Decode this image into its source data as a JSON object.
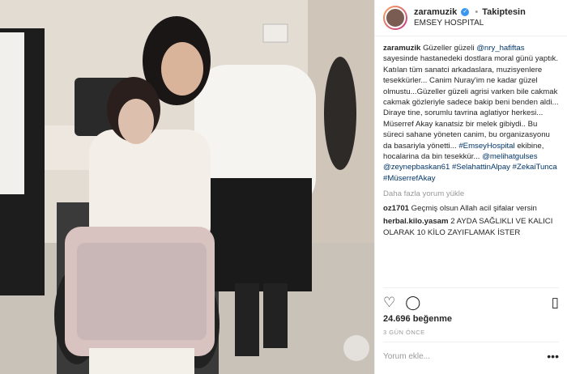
{
  "post": {
    "username": "zaramuzik",
    "follow_status": "Takiptesin",
    "location": "EMSEY HOSPITAL",
    "caption_user": "zaramuzik",
    "caption_parts": [
      {
        "t": "Güzeller güzeli ",
        "k": "text"
      },
      {
        "t": "@nry_hafiftas",
        "k": "link"
      },
      {
        "t": " sayesinde hastanedeki dostlara moral günü yaptık. Katılan tüm sanatci arkadaslara, muzisyenlere tesekkürler... Canim Nuray'im ne kadar güzel olmustu...Güzeller güzeli agrisi varken bile cakmak cakmak gözleriyle sadece bakip beni benden aldi... Diraye tine, sorumlu tavrina aglatiyor herkesi... Müserref Akay kanatsiz bir melek gibiydi.. Bu süreci sahane yöneten canim, bu organizasyonu da basariyla yönetti... ",
        "k": "text"
      },
      {
        "t": "#EmseyHospital",
        "k": "link"
      },
      {
        "t": " ekibine, hocalarina da bin tesekkür... ",
        "k": "text"
      },
      {
        "t": "@melihatgulses",
        "k": "link"
      },
      {
        "t": " ",
        "k": "text"
      },
      {
        "t": "@zeynepbaskan61",
        "k": "link"
      },
      {
        "t": " ",
        "k": "text"
      },
      {
        "t": "#SelahattinAlpay",
        "k": "link"
      },
      {
        "t": " ",
        "k": "text"
      },
      {
        "t": "#ZekaiTunca",
        "k": "link"
      },
      {
        "t": " ",
        "k": "text"
      },
      {
        "t": "#MüserrefAkay",
        "k": "link"
      }
    ],
    "load_more": "Daha fazla yorum yükle",
    "comments": [
      {
        "user": "oz1701",
        "text": "Geçmiş olsun Allah acil şifalar versin"
      },
      {
        "user": "herbal.kilo.yasam",
        "text": "2 AYDA SAĞLIKLI VE KALICI OLARAK 10 KİLO ZAYIFLAMAK İSTER"
      }
    ],
    "likes": "24.696 beğenme",
    "time_ago": "3 GÜN ÖNCE",
    "comment_placeholder": "Yorum ekle...",
    "more_dots": "•••"
  },
  "icons": {
    "heart": "♡",
    "comment": "◯",
    "bookmark": "▯"
  },
  "colors": {
    "link": "#003569",
    "verified": "#3897f0",
    "muted": "#999999"
  }
}
